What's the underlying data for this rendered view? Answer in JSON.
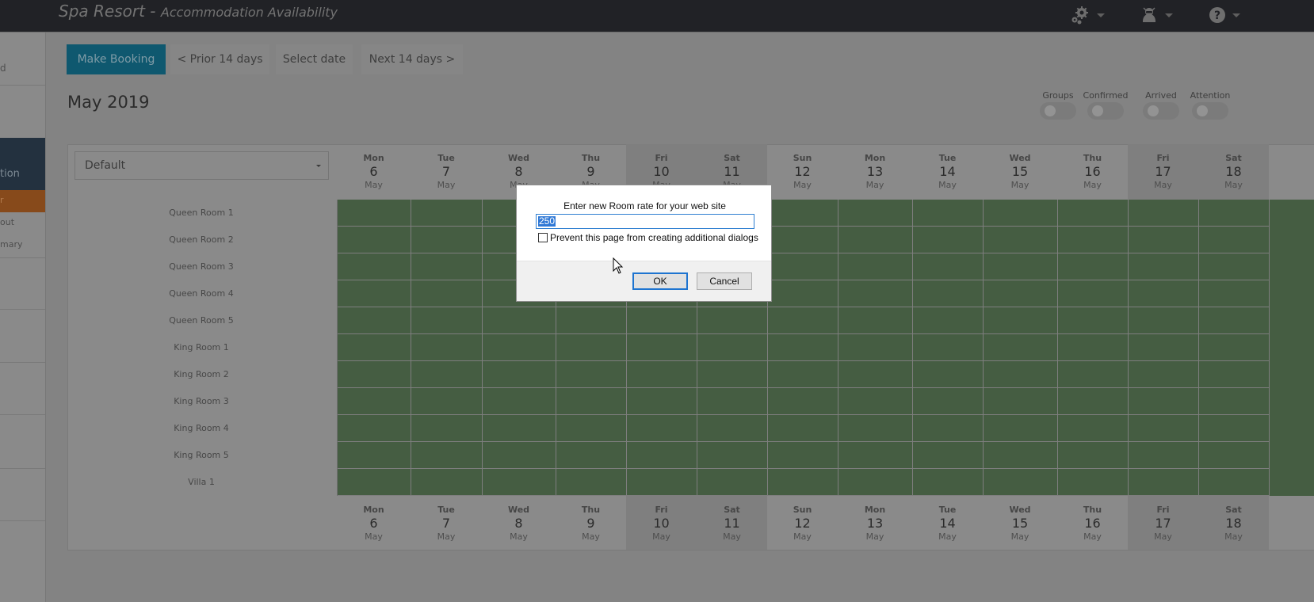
{
  "header": {
    "app_name": "Spa Resort",
    "separator": " - ",
    "page_name": "Accommodation Availability",
    "icons": [
      "settings-gears-icon",
      "user-ninja-icon",
      "help-icon"
    ]
  },
  "sidebar": {
    "items": [
      {
        "label": "d"
      },
      {
        "label": "tion"
      },
      {
        "label": "r"
      },
      {
        "label": "out"
      },
      {
        "label": "mary"
      }
    ]
  },
  "toolbar": {
    "make_booking": "Make Booking",
    "prior": "< Prior 14 days",
    "select_date": "Select date",
    "next": "Next 14 days >"
  },
  "month_title": "May 2019",
  "filters": [
    {
      "label": "Groups",
      "on": false
    },
    {
      "label": "Confirmed",
      "on": false
    },
    {
      "label": "Arrived",
      "on": false
    },
    {
      "label": "Attention",
      "on": false
    }
  ],
  "room_filter": {
    "selected": "Default"
  },
  "days": [
    {
      "dow": "Mon",
      "day": "6",
      "month": "May",
      "weekend": false
    },
    {
      "dow": "Tue",
      "day": "7",
      "month": "May",
      "weekend": false
    },
    {
      "dow": "Wed",
      "day": "8",
      "month": "May",
      "weekend": false
    },
    {
      "dow": "Thu",
      "day": "9",
      "month": "May",
      "weekend": false
    },
    {
      "dow": "Fri",
      "day": "10",
      "month": "May",
      "weekend": true
    },
    {
      "dow": "Sat",
      "day": "11",
      "month": "May",
      "weekend": true
    },
    {
      "dow": "Sun",
      "day": "12",
      "month": "May",
      "weekend": false
    },
    {
      "dow": "Mon",
      "day": "13",
      "month": "May",
      "weekend": false
    },
    {
      "dow": "Tue",
      "day": "14",
      "month": "May",
      "weekend": false
    },
    {
      "dow": "Wed",
      "day": "15",
      "month": "May",
      "weekend": false
    },
    {
      "dow": "Thu",
      "day": "16",
      "month": "May",
      "weekend": false
    },
    {
      "dow": "Fri",
      "day": "17",
      "month": "May",
      "weekend": true
    },
    {
      "dow": "Sat",
      "day": "18",
      "month": "May",
      "weekend": true
    }
  ],
  "rooms": [
    "Queen Room 1",
    "Queen Room 2",
    "Queen Room 3",
    "Queen Room 4",
    "Queen Room 5",
    "King Room 1",
    "King Room 2",
    "King Room 3",
    "King Room 4",
    "King Room 5",
    "Villa 1"
  ],
  "availability_color": "#455d42",
  "dialog": {
    "message": "Enter new Room rate for your web site",
    "value": "250",
    "checkbox_label": "Prevent this page from creating additional dialogs",
    "checkbox_checked": false,
    "ok": "OK",
    "cancel": "Cancel"
  }
}
